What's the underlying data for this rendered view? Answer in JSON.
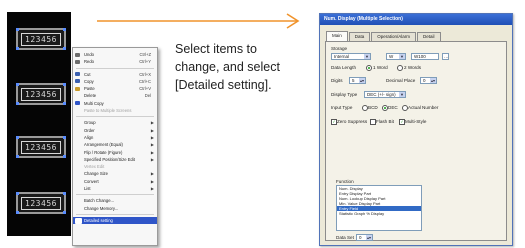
{
  "canvas": {
    "numeric_displays": [
      "123456",
      "123456",
      "123456",
      "123456"
    ]
  },
  "context_menu": {
    "items": [
      {
        "label": "Undo",
        "shortcut": "Ctrl+Z",
        "icon": "undo-icon",
        "color": "#6b6b6b"
      },
      {
        "label": "Redo",
        "shortcut": "Ctrl+Y",
        "icon": "redo-icon",
        "color": "#6b6b6b"
      },
      {
        "sep": true
      },
      {
        "label": "Cut",
        "shortcut": "Ctrl+X",
        "icon": "cut-icon",
        "color": "#3a5fb0"
      },
      {
        "label": "Copy",
        "shortcut": "Ctrl+C",
        "icon": "copy-icon",
        "color": "#3a5fb0"
      },
      {
        "label": "Paste",
        "shortcut": "Ctrl+V",
        "icon": "paste-icon",
        "color": "#c89a2a"
      },
      {
        "label": "Delete",
        "shortcut": "Del",
        "icon": "",
        "color": ""
      },
      {
        "label": "Multi Copy",
        "shortcut": "",
        "icon": "multi-copy-icon",
        "color": "#2f55c8"
      },
      {
        "label": "Paste to Multiple Screens",
        "shortcut": "",
        "icon": "",
        "color": "",
        "disabled": true
      },
      {
        "sep": true
      },
      {
        "label": "Group",
        "arrow": true
      },
      {
        "label": "Order",
        "arrow": true
      },
      {
        "label": "Align",
        "arrow": true
      },
      {
        "label": "Arrangement (Equal)",
        "arrow": true
      },
      {
        "label": "Flip / Rotate (Figure)",
        "arrow": true
      },
      {
        "label": "Specified Position/Size Edit",
        "arrow": true
      },
      {
        "label": "Vertex Edit",
        "disabled": true
      },
      {
        "label": "Change Size",
        "arrow": true
      },
      {
        "label": "Convert",
        "arrow": true
      },
      {
        "label": "List",
        "arrow": true
      },
      {
        "sep": true
      },
      {
        "label": "Batch Change..."
      },
      {
        "label": "Change Memory..."
      },
      {
        "sep": true
      },
      {
        "label": "Detailed setting",
        "icon": "detailed-setting-icon",
        "color": "#ffffff",
        "highlighted": true
      }
    ]
  },
  "caption": {
    "line1": "Select items to",
    "line2": "change, and select",
    "line3": "[Detailed setting]."
  },
  "dialog": {
    "title": "Num. Display (Multiple Selection)",
    "tabs": [
      "Main",
      "Data",
      "Operation/Alarm",
      "Detail"
    ],
    "fields": {
      "storage_label": "Storage",
      "storage_type": "Internal",
      "storage_unit": "W",
      "storage_addr": "W100",
      "data_length_label": "Data Length",
      "data_length_1": "1 Word",
      "data_length_2": "2 Words",
      "digits_label": "Digits",
      "digits_value": "5",
      "decimal_label": "Decimal Place",
      "decimal_value": "0",
      "display_type_label": "Display Type",
      "display_type_value": "DEC (+/- sign)",
      "input_type_label": "Input Type",
      "input_bcd": "BCD",
      "input_dec": "DEC",
      "input_actual": "Actual Number",
      "zero_suppress": "Zero Suppress",
      "flash_bit": "Flash Bit",
      "multi_style": "Multi-Style"
    },
    "function_label": "Function",
    "functions": [
      "Num. Display",
      "Entry Display Part",
      "Num. Lookup Display Part",
      "Min. Value Display Part",
      "Entry Field",
      "Statistic Graph % Display"
    ],
    "selected_function_index": 4,
    "bottom_label": "Data Set",
    "bottom_value": "0"
  },
  "colors": {
    "arrow": "#f0932b",
    "highlight": "#2f55c8"
  }
}
